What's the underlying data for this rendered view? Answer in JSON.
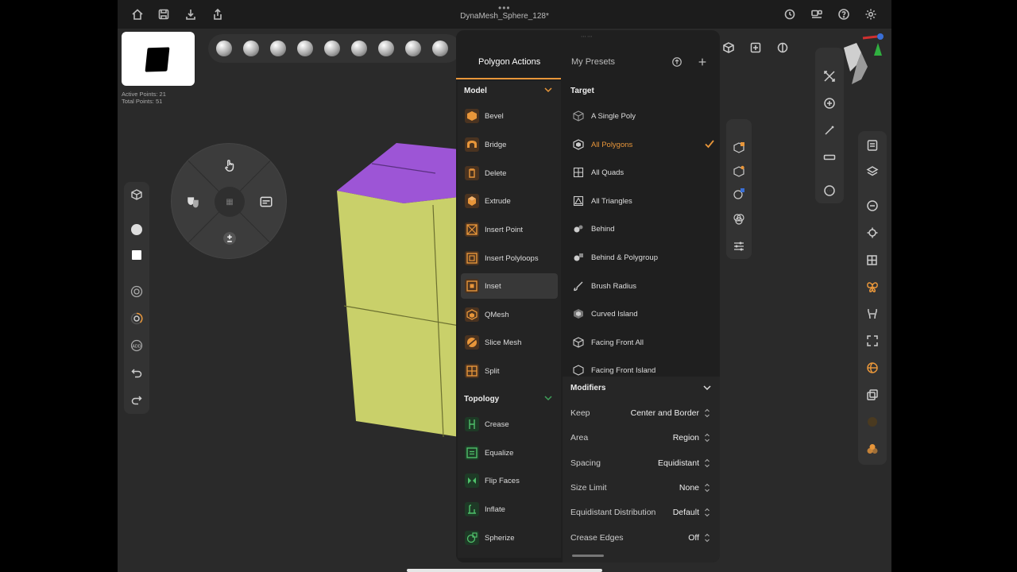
{
  "document": {
    "title": "DynaMesh_Sphere_128*"
  },
  "stats": {
    "active_points": "Active Points: 21",
    "total_points": "Total Points: 51"
  },
  "panel": {
    "tabs": [
      {
        "label": "Polygon Actions"
      },
      {
        "label": "My Presets"
      }
    ],
    "model": {
      "title": "Model",
      "items": [
        {
          "label": "Bevel",
          "icon": "bevel-icon"
        },
        {
          "label": "Bridge",
          "icon": "bridge-icon"
        },
        {
          "label": "Delete",
          "icon": "delete-icon"
        },
        {
          "label": "Extrude",
          "icon": "extrude-icon"
        },
        {
          "label": "Insert Point",
          "icon": "insert-point-icon"
        },
        {
          "label": "Insert Polyloops",
          "icon": "insert-polyloops-icon"
        },
        {
          "label": "Inset",
          "icon": "inset-icon"
        },
        {
          "label": "QMesh",
          "icon": "qmesh-icon"
        },
        {
          "label": "Slice Mesh",
          "icon": "slice-mesh-icon"
        },
        {
          "label": "Split",
          "icon": "split-icon"
        }
      ]
    },
    "topology": {
      "title": "Topology",
      "items": [
        {
          "label": "Crease",
          "icon": "crease-icon"
        },
        {
          "label": "Equalize",
          "icon": "equalize-icon"
        },
        {
          "label": "Flip Faces",
          "icon": "flip-faces-icon"
        },
        {
          "label": "Inflate",
          "icon": "inflate-icon"
        },
        {
          "label": "Spherize",
          "icon": "spherize-icon"
        }
      ]
    },
    "target": {
      "title": "Target",
      "items": [
        {
          "label": "A Single Poly"
        },
        {
          "label": "All Polygons"
        },
        {
          "label": "All Quads"
        },
        {
          "label": "All Triangles"
        },
        {
          "label": "Behind"
        },
        {
          "label": "Behind & Polygroup"
        },
        {
          "label": "Brush Radius"
        },
        {
          "label": "Curved Island"
        },
        {
          "label": "Facing Front All"
        },
        {
          "label": "Facing Front Island"
        }
      ]
    },
    "modifiers": {
      "title": "Modifiers",
      "rows": [
        {
          "key": "Keep",
          "value": "Center and Border"
        },
        {
          "key": "Area",
          "value": "Region"
        },
        {
          "key": "Spacing",
          "value": "Equidistant"
        },
        {
          "key": "Size Limit",
          "value": "None"
        },
        {
          "key": "Equidistant Distribution",
          "value": "Default"
        },
        {
          "key": "Crease Edges",
          "value": "Off"
        }
      ]
    }
  },
  "colors": {
    "accent": "#e8963a",
    "model_top": "#9d55d6",
    "model_side": "#c9d06a",
    "topology_icon": "#3fa05a"
  }
}
